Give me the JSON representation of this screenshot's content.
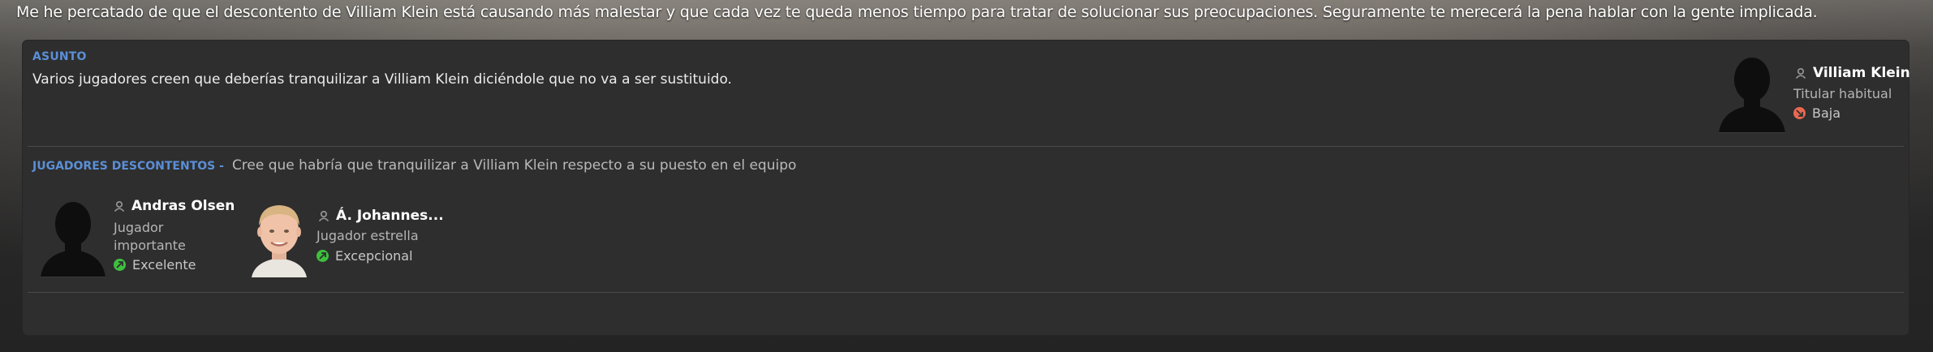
{
  "intro": "Me he percatado de que el descontento de Villiam Klein está causando más malestar y que cada vez te queda menos tiempo para tratar de solucionar sus preocupaciones. Seguramente te merecerá la pena hablar con la gente implicada.",
  "subject": {
    "label": "ASUNTO",
    "text": "Varios jugadores creen que deberías tranquilizar a Villiam Klein diciéndole que no va a ser sustituido."
  },
  "subject_player": {
    "name": "Villiam Klein",
    "role": "Titular habitual",
    "status": "Baja",
    "status_color": "#e8684f"
  },
  "unhappy": {
    "label": "JUGADORES DESCONTENTOS -",
    "description": "Cree que habría que tranquilizar a Villiam Klein respecto a su puesto en el equipo",
    "players": [
      {
        "name": "Andras Olsen",
        "role_line1": "Jugador",
        "role_line2": "importante",
        "status": "Excelente",
        "status_color": "#3fbf3f"
      },
      {
        "name": "Á. Johannes...",
        "role": "Jugador estrella",
        "status": "Excepcional",
        "status_color": "#3fbf3f"
      }
    ]
  },
  "icons": {
    "person": "person-icon",
    "status_down": "arrow-down-circle-icon",
    "status_up": "arrow-up-circle-icon"
  },
  "colors": {
    "accent_blue": "#5b8fd6",
    "panel": "#2e2e2e"
  }
}
